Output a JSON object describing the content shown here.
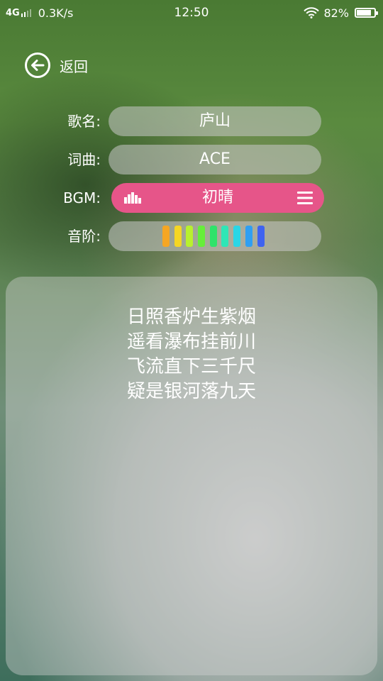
{
  "status_bar": {
    "network": "4G",
    "speed": "0.3K/s",
    "time": "12:50",
    "battery": "82%",
    "battery_level": 0.82,
    "icons": [
      "signal-icon",
      "wifi-icon",
      "battery-icon"
    ]
  },
  "back": {
    "label": "返回",
    "icon": "back-arrow-icon"
  },
  "song": {
    "name_label": "歌名:",
    "name": "庐山",
    "lyricist_label": "词曲:",
    "lyricist": "ACE",
    "bgm_label": "BGM:",
    "bgm": "初晴",
    "bgm_icons": [
      "equalizer-icon",
      "menu-icon"
    ],
    "bgm_color": "#e65589",
    "scale_label": "音阶:",
    "scale_colors": [
      "#f5a623",
      "#f5d623",
      "#b8f12e",
      "#66ee3a",
      "#2fe36a",
      "#2fe6b6",
      "#2ad6e6",
      "#2f9ff2",
      "#3f63f0"
    ]
  },
  "lyrics": [
    "日照香炉生紫烟",
    "遥看瀑布挂前川",
    "飞流直下三千尺",
    "疑是银河落九天"
  ]
}
